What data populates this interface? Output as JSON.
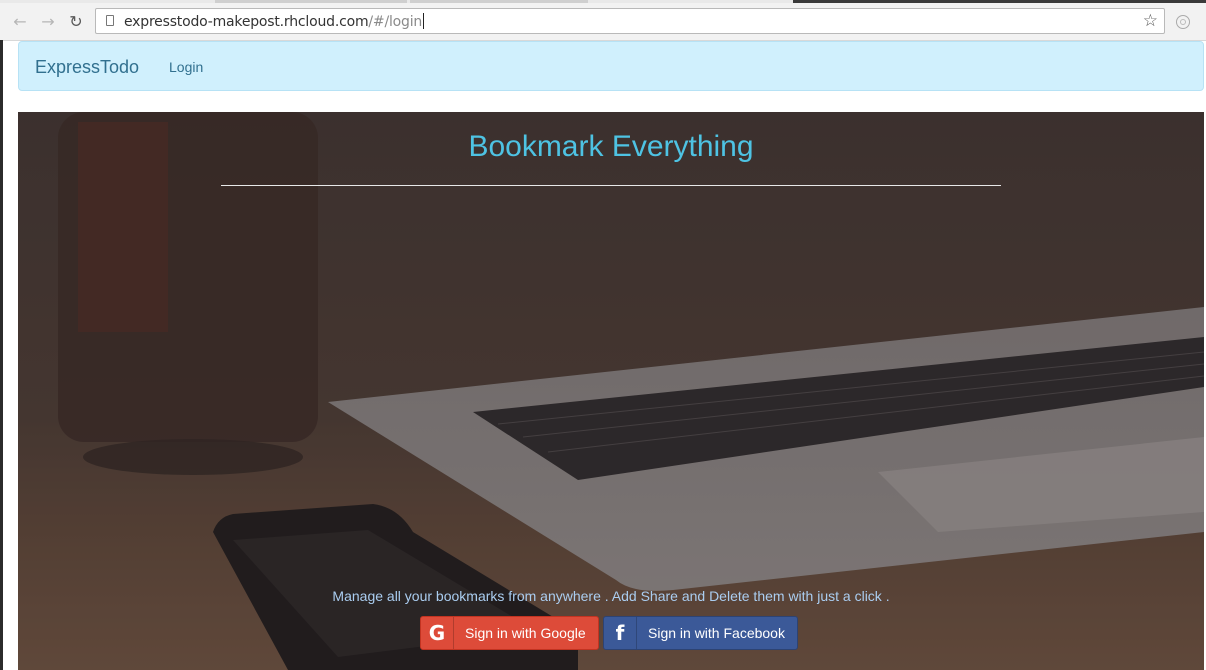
{
  "browser": {
    "url_host": "expresstodo-makepost.rhcloud.com",
    "url_path": "/#/login",
    "icons": [
      "back-icon",
      "forward-icon",
      "reload-icon",
      "page-icon",
      "star-icon",
      "extension-icon"
    ]
  },
  "navbar": {
    "brand": "ExpressTodo",
    "links": [
      "Login"
    ],
    "colors": {
      "background": "#d0f0fd",
      "text": "#31708f"
    }
  },
  "hero": {
    "title": "Bookmark Everything",
    "tagline": "Manage all your bookmarks from anywhere . Add Share and Delete them with just a click .",
    "buttons": {
      "google": {
        "label": "Sign in with Google",
        "icon": "google-icon",
        "color": "#dd4b39"
      },
      "facebook": {
        "label": "Sign in with Facebook",
        "icon": "facebook-icon",
        "color": "#3b5998"
      }
    },
    "colors": {
      "title": "#4ec3e3",
      "tagline": "#aacdf0"
    }
  }
}
